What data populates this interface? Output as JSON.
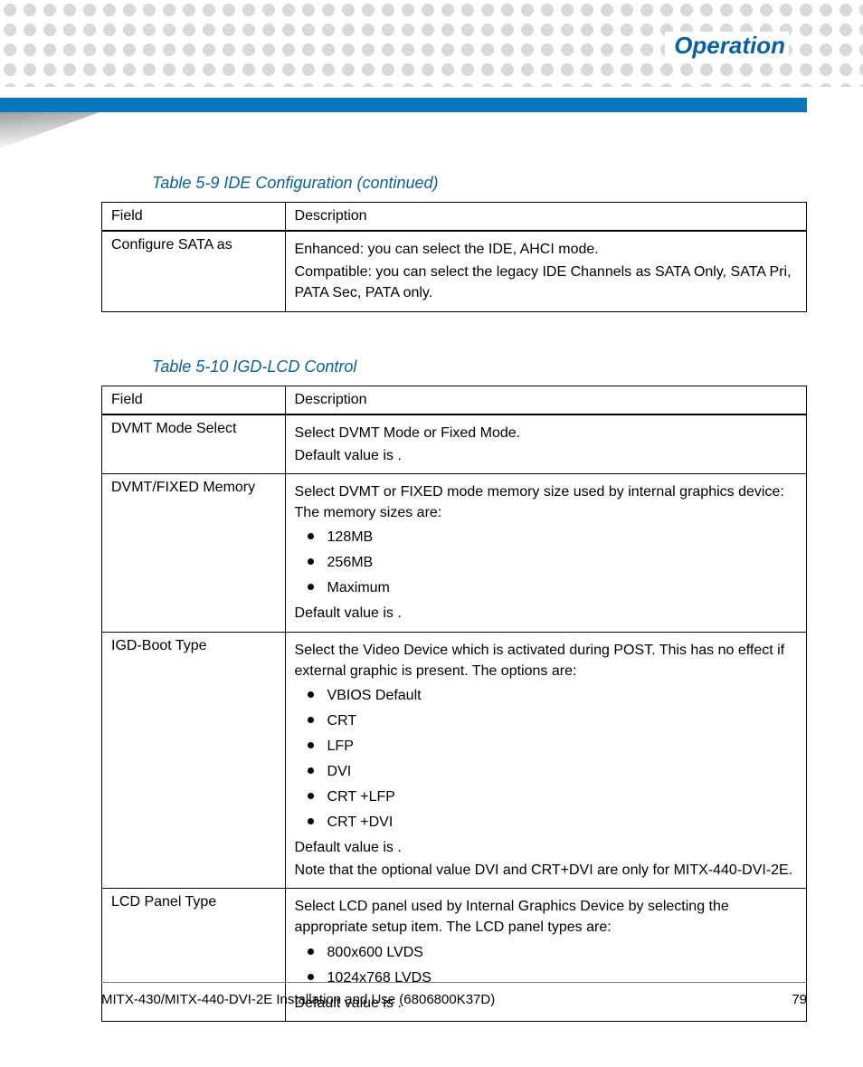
{
  "header": {
    "section_title": "Operation"
  },
  "tables": {
    "t59": {
      "caption": "Table 5-9 IDE Configuration (continued)",
      "headers": [
        "Field",
        "Description"
      ],
      "rows": [
        {
          "field": "Configure SATA as",
          "lines": [
            "Enhanced: you can select the IDE, AHCI mode.",
            "Compatible: you can select the legacy IDE Channels as SATA Only, SATA Pri, PATA Sec, PATA only."
          ]
        }
      ]
    },
    "t510": {
      "caption": "Table 5-10 IGD-LCD Control",
      "headers": [
        "Field",
        "Description"
      ],
      "rows": [
        {
          "field": "DVMT Mode Select",
          "lines": [
            "Select DVMT Mode or Fixed Mode.",
            "Default value is                             ."
          ]
        },
        {
          "field": "DVMT/FIXED Memory",
          "intro": "Select DVMT or FIXED mode memory size used by internal graphics device: The memory sizes are:",
          "options": [
            "128MB",
            "256MB",
            "Maximum"
          ],
          "trail": [
            "Default value is              ."
          ]
        },
        {
          "field": "IGD-Boot Type",
          "intro": "Select the Video Device which is activated during POST. This has no effect if external graphic is present. The options are:",
          "options": [
            "VBIOS Default",
            "CRT",
            "LFP",
            "DVI",
            "CRT +LFP",
            "CRT +DVI"
          ],
          "trail": [
            "Default value is                              .",
            "Note that the optional value DVI and CRT+DVI are only for MITX-440-DVI-2E."
          ]
        },
        {
          "field": "LCD Panel Type",
          "intro": "Select LCD panel used by Internal Graphics Device by selecting the appropriate setup item. The LCD panel types are:",
          "options": [
            "800x600 LVDS",
            "1024x768 LVDS"
          ],
          "trail": [
            "Default value is                                          ."
          ]
        }
      ]
    }
  },
  "footer": {
    "doc": "MITX-430/MITX-440-DVI-2E Installation and Use (6806800K37D)",
    "page": "79"
  }
}
